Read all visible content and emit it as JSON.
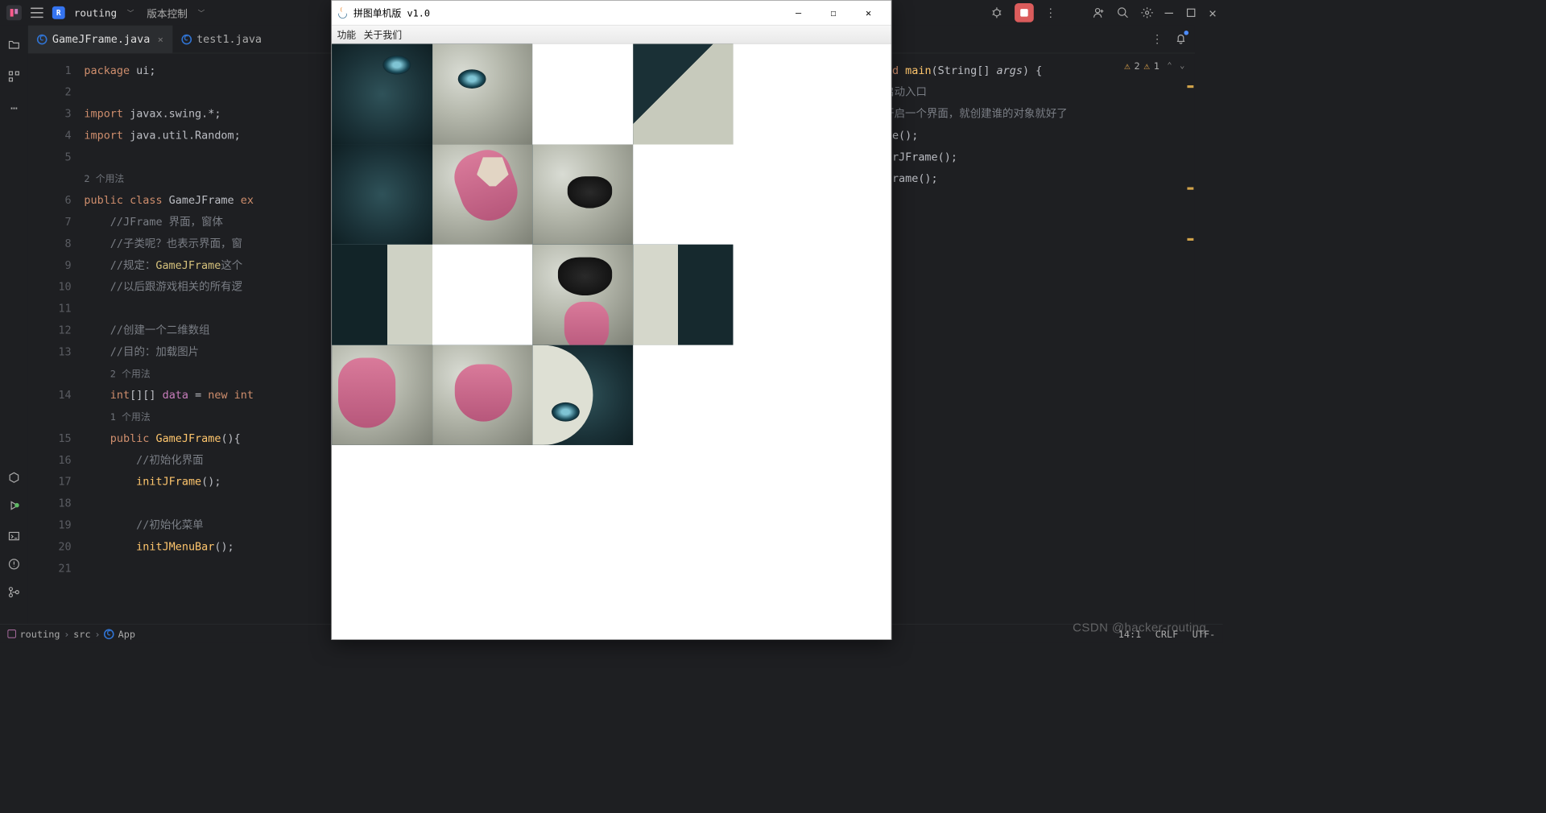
{
  "topbar": {
    "project_letter": "R",
    "project_name": "routing",
    "vcs_label": "版本控制"
  },
  "tabs": [
    {
      "name": "GameJFrame.java",
      "active": true,
      "closeable": true
    },
    {
      "name": "test1.java",
      "active": false,
      "closeable": false
    }
  ],
  "warnings": {
    "w1": "2",
    "w2": "1"
  },
  "gutter_lines": [
    "1",
    "2",
    "3",
    "4",
    "5",
    "",
    "6",
    "7",
    "8",
    "9",
    "10",
    "11",
    "12",
    "13",
    "",
    "14",
    "",
    "15",
    "16",
    "17",
    "18",
    "19",
    "20",
    "21"
  ],
  "left_code": {
    "l1_a": "package ",
    "l1_b": "ui",
    "l1_c": ";",
    "l3_a": "import ",
    "l3_b": "javax.swing.*",
    "l3_c": ";",
    "l4_a": "import ",
    "l4_b": "java.util.Random",
    "l4_c": ";",
    "u1": "2 个用法",
    "l6_a": "public class ",
    "l6_b": "GameJFrame ",
    "l6_c": "ex",
    "l7": "//JFrame 界面，窗体",
    "l8": "//子类呢？也表示界面，窗",
    "l9_a": "//规定：",
    "l9_b": "GameJFrame",
    "l9_c": "这个",
    "l10": "//以后跟游戏相关的所有逻",
    "l12": "//创建一个二维数组",
    "l13": "//目的：加载图片",
    "u2": "2 个用法",
    "l14_a": "int",
    "l14_b": "[][] ",
    "l14_c": "data",
    "l14_d": " = ",
    "l14_e": "new ",
    "l14_f": "int",
    "u3": "1 个用法",
    "l15_a": "public ",
    "l15_b": "GameJFrame",
    "l15_c": "(){",
    "l16": "//初始化界面",
    "l17_a": "initJFrame",
    "l17_b": "();",
    "l19": "//初始化菜单",
    "l20_a": "initJMenuBar",
    "l20_b": "();"
  },
  "right_code": {
    "r1_a": "void ",
    "r1_b": "main",
    "r1_c": "(",
    "r1_d": "String",
    "r1_e": "[] ",
    "r1_f": "args",
    "r1_g": ") {",
    "r2": "的启动入口",
    "r3": "要开启一个界面，就创建谁的对象就好了",
    "r4": "rame();",
    "r5": "sterJFrame();",
    "r6": "nJFrame();"
  },
  "crumb": {
    "root": "routing",
    "src": "src",
    "app": "App",
    "pos": "14:1",
    "eol": "CRLF",
    "enc": "UTF-",
    "wm": "CSDN @hacker-routing"
  },
  "popup": {
    "title": "拼图单机版 v1.0",
    "menu": [
      "功能",
      "关于我们"
    ],
    "tiles": [
      "dark-eye",
      "eye",
      "empty",
      "fur-dark",
      "dark",
      "mouth",
      "nose-fur",
      "empty",
      "dark-fur",
      "empty",
      "nose",
      "fur-dark2",
      "tongue",
      "tongue2",
      "eye2",
      "empty"
    ]
  }
}
